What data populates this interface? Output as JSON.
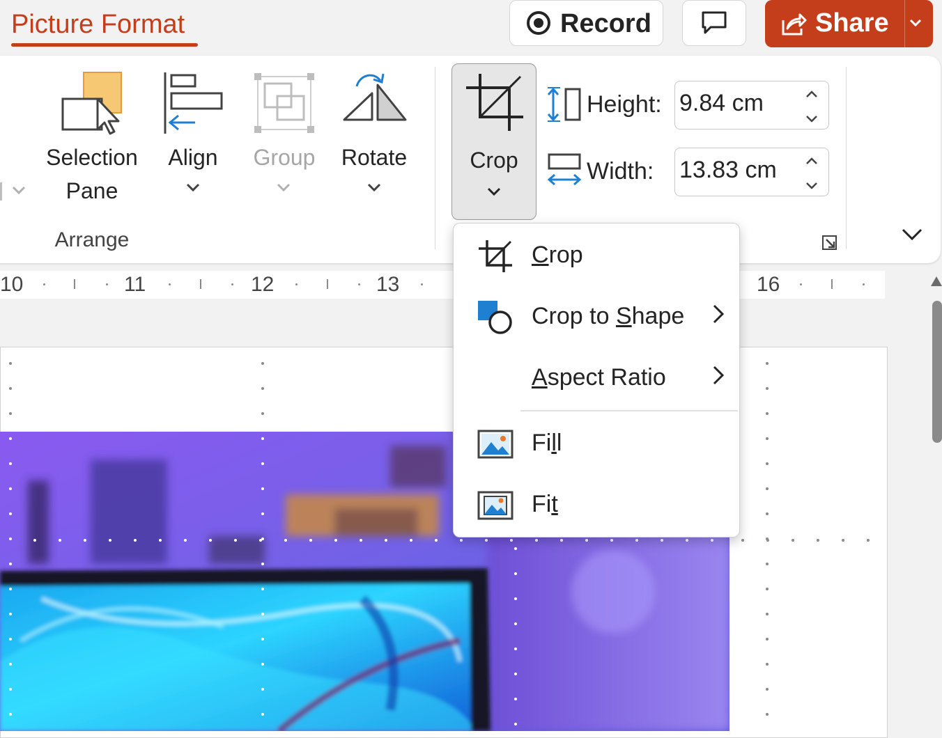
{
  "header": {
    "active_tab": "Picture Format",
    "record_label": "Record",
    "share_label": "Share"
  },
  "ribbon": {
    "arrange_group": {
      "group_label": "Arrange",
      "selection_pane_label": [
        "Selection",
        "Pane"
      ],
      "align_label": "Align",
      "group_button_label": "Group",
      "rotate_label": "Rotate"
    },
    "size_group": {
      "crop_label": "Crop",
      "height_label": "Height:",
      "height_value": "9.84 cm",
      "width_label": "Width:",
      "width_value": "13.83 cm"
    }
  },
  "ruler": {
    "numbers": [
      "10",
      "11",
      "12",
      "13",
      "16"
    ]
  },
  "crop_menu": {
    "items": [
      {
        "pre": "",
        "key": "C",
        "post": "rop",
        "has_submenu": false
      },
      {
        "pre": "Crop to ",
        "key": "S",
        "post": "hape",
        "has_submenu": true
      },
      {
        "pre": "",
        "key": "A",
        "post": "spect Ratio",
        "has_submenu": true
      },
      {
        "pre": "Fi",
        "key": "l",
        "post": "l",
        "has_submenu": false
      },
      {
        "pre": "Fi",
        "key": "t",
        "post": "",
        "has_submenu": false
      }
    ]
  },
  "colors": {
    "accent": "#c43e1c",
    "icon_blue": "#1f7fd0",
    "selection_orange": "#f7c873"
  }
}
